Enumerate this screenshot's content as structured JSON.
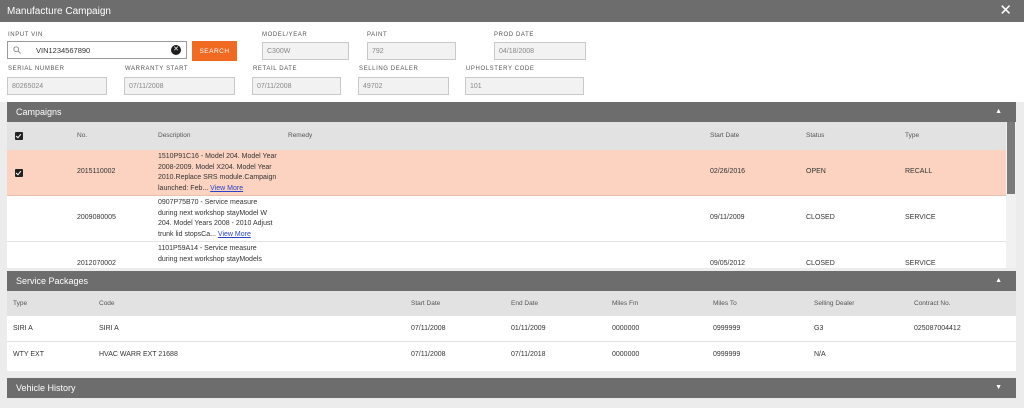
{
  "window": {
    "title": "Manufacture Campaign",
    "close_icon": "close-icon"
  },
  "form": {
    "vin_label": "INPUT VIN",
    "vin_value": "VIN1234567890",
    "search_label": "SEARCH",
    "model_year_label": "MODEL/YEAR",
    "model_year_value": "C300W",
    "paint_label": "PAINT",
    "paint_value": "792",
    "prod_date_label": "PROD DATE",
    "prod_date_value": "04/18/2008",
    "serial_label": "SERIAL NUMBER",
    "serial_value": "80265024",
    "warranty_label": "WARRANTY START",
    "warranty_value": "07/11/2008",
    "retail_label": "RETAIL DATE",
    "retail_value": "07/11/2008",
    "dealer_label": "SELLING DEALER",
    "dealer_value": "49702",
    "upholstery_label": "UPHOLSTERY CODE",
    "upholstery_value": "101"
  },
  "campaigns": {
    "title": "Campaigns",
    "headers": {
      "no": "No.",
      "description": "Description",
      "remedy": "Remedy",
      "start_date": "Start Date",
      "status": "Status",
      "type": "Type"
    },
    "rows": [
      {
        "no": "2015110002",
        "desc_lines": [
          "1510P91C16 - Model 204. Model Year",
          "2008-2009. Model X204. Model Year",
          "2010.Replace SRS module.Campaign",
          "launched: Feb..."
        ],
        "view_more": "View More",
        "start_date": "02/26/2016",
        "status": "OPEN",
        "type": "RECALL"
      },
      {
        "no": "2009080005",
        "desc_lines": [
          "0907P75B70 - Service measure",
          "during next workshop stayModel W",
          "204. Model Years 2008 - 2010 Adjust",
          "trunk lid stopsCa..."
        ],
        "view_more": "View More",
        "start_date": "09/11/2009",
        "status": "CLOSED",
        "type": "SERVICE"
      },
      {
        "no": "2012070002",
        "desc_lines": [
          "1101P59A14 - Service measure",
          "during next workshop stayModels"
        ],
        "start_date": "09/05/2012",
        "status": "CLOSED",
        "type": "SERVICE"
      }
    ]
  },
  "service_packages": {
    "title": "Service Packages",
    "headers": {
      "type": "Type",
      "code": "Code",
      "start_date": "Start Date",
      "end_date": "End Date",
      "miles_fm": "Miles Fm",
      "miles_to": "Miles To",
      "selling_dealer": "Selling Dealer",
      "contract_no": "Contract No."
    },
    "rows": [
      {
        "type": "SIRI A",
        "code": "SIRI A",
        "start_date": "07/11/2008",
        "end_date": "01/11/2009",
        "miles_fm": "0000000",
        "miles_to": "0999999",
        "selling_dealer": "G3",
        "contract_no": "025087004412"
      },
      {
        "type": "WTY EXT",
        "code": "HVAC WARR EXT 21688",
        "start_date": "07/11/2008",
        "end_date": "07/11/2018",
        "miles_fm": "0000000",
        "miles_to": "0999999",
        "selling_dealer": "N/A",
        "contract_no": ""
      }
    ]
  },
  "vehicle_history": {
    "title": "Vehicle History"
  },
  "colors": {
    "header_gray": "#6d6d6d",
    "accent_orange": "#f06a22",
    "highlight_row": "#fbd3c0",
    "link_blue": "#2a44c9"
  }
}
